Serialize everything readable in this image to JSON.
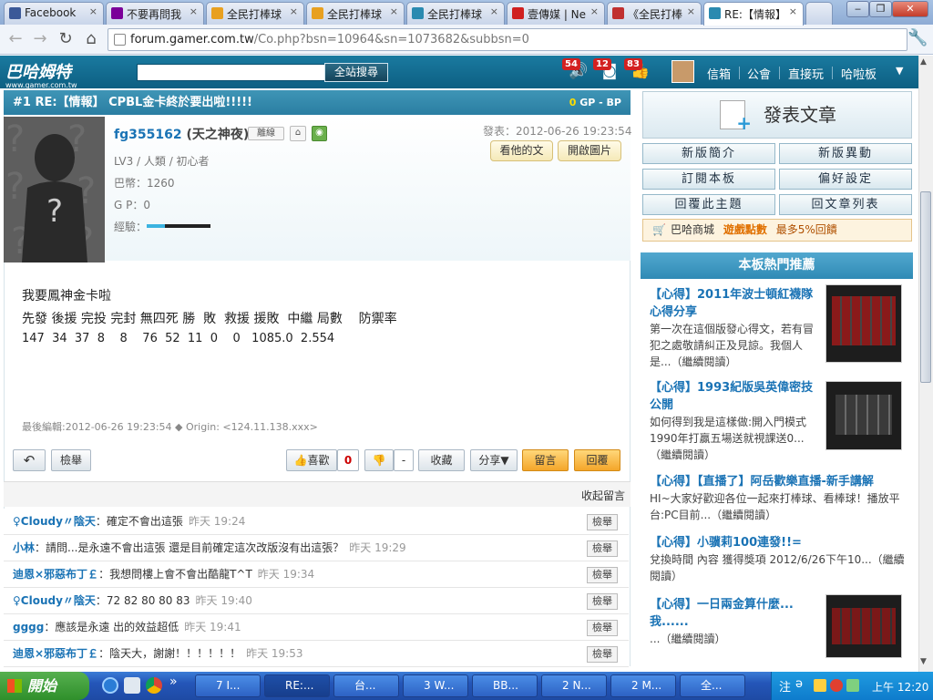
{
  "browser": {
    "tabs": [
      {
        "label": "Facebook",
        "color": "#3b5998"
      },
      {
        "label": "不要再問我",
        "color": "#7b0099"
      },
      {
        "label": "全民打棒球",
        "color": "#e8a020"
      },
      {
        "label": "全民打棒球",
        "color": "#e8a020"
      },
      {
        "label": "全民打棒球",
        "color": "#2a8ab0"
      },
      {
        "label": "壹傳媒 | Ne",
        "color": "#d02020"
      },
      {
        "label": "《全民打棒",
        "color": "#c03030"
      },
      {
        "label": "RE:【情報】",
        "color": "#2a8ab0"
      }
    ],
    "url_host": "forum.gamer.com.tw",
    "url_path": "/Co.php?bsn=10964&sn=1073682&subbsn=0"
  },
  "site": {
    "logo": "巴哈姆特",
    "logo_sub": "www.gamer.com.tw",
    "search_button": "全站搜尋",
    "badges": [
      "54",
      "12",
      "83"
    ],
    "links": [
      "信箱",
      "公會",
      "直接玩",
      "哈啦板"
    ]
  },
  "post": {
    "title": "#1 RE:【情報】 CPBL金卡終於要出啦!!!!!",
    "gp": "0",
    "gp_label": "GP",
    "bp_label": "- BP",
    "user_id": "fg355162",
    "nickname": "(天之神夜)",
    "status_tag": "離線",
    "posted": "發表：2012-06-26 19:23:54",
    "info_level": "LV3 / 人類 / 初心者",
    "info_coins": "巴幣：1260",
    "info_gp": "G P：0",
    "info_exp": "經驗：",
    "btn_his_posts": "看他的文",
    "btn_open_images": "開啟圖片",
    "content_line1": "我要鳳神金卡啦",
    "content_line2": "先發 後援 完投 完封 無四死 勝  敗  救援 援敗  中繼 局數    防禦率",
    "content_line3": "147  34  37  8    8    76  52  11  0    0   1085.0  2.554",
    "edited": "最後編輯:2012-06-26 19:23:54 ◆ Origin: <124.11.138.xxx>",
    "actions": {
      "report": "檢舉",
      "like": "喜歡",
      "like_count": "0",
      "dislike_count": "-",
      "collect": "收藏",
      "share": "分享▼",
      "comment": "留言",
      "reply": "回覆"
    },
    "collapse_comments": "收起留言"
  },
  "comments": [
    {
      "user": "♀Cloudy〃陰天",
      "text": "：確定不會出這張",
      "time": "昨天 19:24"
    },
    {
      "user": "小林",
      "text": "：請問...是永遠不會出這張 還是目前確定這次改版沒有出這張？",
      "time": "昨天 19:29"
    },
    {
      "user": "迪恩×邪惡布丁￡",
      "text": "：我想問樓上會不會出酷龍T^T",
      "time": "昨天 19:34"
    },
    {
      "user": "♀Cloudy〃陰天",
      "text": "：72 82 80 80 83",
      "time": "昨天 19:40"
    },
    {
      "user": "gggg",
      "text": "：應該是永遠 出的效益超低",
      "time": "昨天 19:41"
    },
    {
      "user": "迪恩×邪惡布丁￡",
      "text": "：陰天大，謝謝！！！！！！",
      "time": "昨天 19:53"
    }
  ],
  "comment_report_label": "檢舉",
  "sidebar": {
    "post_button": "發表文章",
    "grid": [
      "新版簡介",
      "新版異動",
      "訂閱本板",
      "偏好設定",
      "回覆此主題",
      "回文章列表"
    ],
    "shop_text": "巴哈商城",
    "shop_highlight": "遊戲點數",
    "shop_tail": "最多5%回饋",
    "hot_header": "本板熱門推薦",
    "hot": [
      {
        "title": "【心得】2011年波士頓紅襪隊心得分享",
        "desc": "第一次在這個版發心得文，若有冒犯之處敬請糾正及見諒。我個人是...（繼續閱讀）"
      },
      {
        "title": "【心得】1993紀版吳英偉密技公開",
        "desc": "如何得到我是這樣做:開入門模式1990年打贏五場送就視課送0...（繼續閱讀）"
      },
      {
        "title": "【心得】【直播了】阿岳歡樂直播-新手講解",
        "desc": "HI~大家好歡迎各位一起來打棒球、看棒球！播放平台:PC目前...（繼續閱讀）"
      },
      {
        "title": "【心得】小骥莉100連發!!=",
        "desc": "兌換時間 內容 獲得獎項 2012/6/26下午10...（繼續閱讀）"
      },
      {
        "title": "【心得】一日兩金算什麼...我......",
        "desc": "...（繼續閱讀）"
      }
    ]
  },
  "taskbar": {
    "start": "開始",
    "buttons": [
      "7 I...",
      "RE:...",
      "台...",
      "3 W...",
      "BB...",
      "2 N...",
      "2 M...",
      "全..."
    ],
    "clock": "上午 12:20"
  }
}
